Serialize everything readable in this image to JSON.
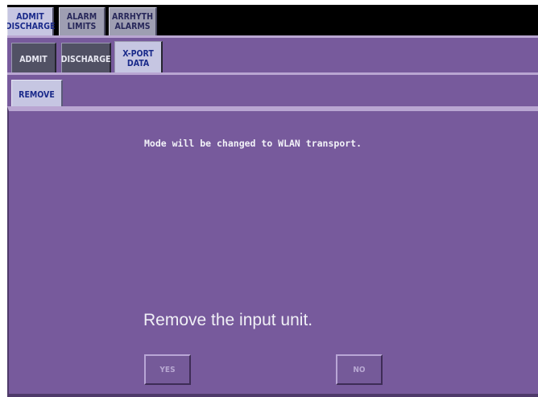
{
  "tabs_level1": [
    {
      "label_line1": "ADMIT",
      "label_line2": "DISCHARGE",
      "active": true
    },
    {
      "label_line1": "ALARM",
      "label_line2": "LIMITS",
      "active": false
    },
    {
      "label_line1": "ARRHYTH",
      "label_line2": "ALARMS",
      "active": false
    }
  ],
  "tabs_level2": [
    {
      "label_line1": "ADMIT",
      "label_line2": "",
      "active": false
    },
    {
      "label_line1": "DISCHARGE",
      "label_line2": "",
      "active": false
    },
    {
      "label_line1": "X-PORT",
      "label_line2": "DATA",
      "active": true
    }
  ],
  "tabs_level3": [
    {
      "label": "REMOVE",
      "active": true
    }
  ],
  "dialog": {
    "message": "Mode will be changed to WLAN transport.",
    "instruction": "Remove the input unit.",
    "yes_label": "YES",
    "no_label": "NO"
  },
  "colors": {
    "panel": "#775a9c",
    "active_tab": "#c6c6e2",
    "inactive_tab_top": "#9e9eb2",
    "inactive_tab_mid": "#515164"
  }
}
